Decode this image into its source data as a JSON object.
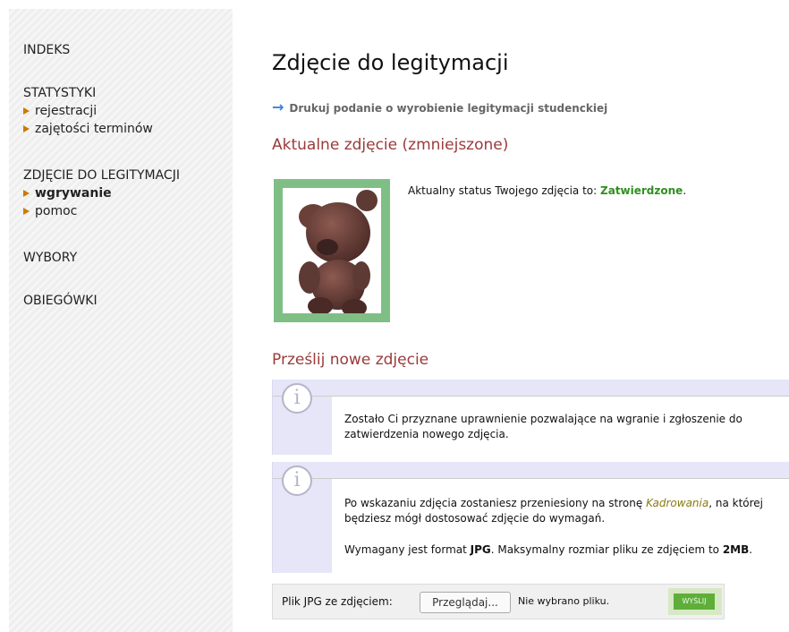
{
  "sidebar": {
    "indeks": "INDEKS",
    "statystyki": "STATYSTYKI",
    "statystyki_items": [
      "rejestracji",
      "zajętości terminów"
    ],
    "zdjecie": "ZDJĘCIE DO LEGITYMACJI",
    "zdjecie_items": [
      "wgrywanie",
      "pomoc"
    ],
    "wybory": "WYBORY",
    "obiegowki": "OBIEGÓWKI"
  },
  "main": {
    "title": "Zdjęcie do legitymacji",
    "print_link": "Drukuj podanie o wyrobienie legitymacji studenckiej",
    "current_heading": "Aktualne zdjęcie (zmniejszone)",
    "status_prefix": "Aktualny status Twojego zdjęcia to:",
    "status_value": "Zatwierdzone",
    "status_suffix": ".",
    "upload_heading": "Prześlij nowe zdjęcie",
    "info1": "Zostało Ci przyznane uprawnienie pozwalające na wgranie i zgłoszenie do zatwierdzenia nowego zdjęcia.",
    "info2_a": "Po wskazaniu zdjęcia zostaniesz przeniesiony na stronę ",
    "info2_link": "Kadrowania",
    "info2_b": ", na której będziesz mógł dostosować zdjęcie do wymagań.",
    "info3_a": "Wymagany jest format ",
    "info3_fmt": "JPG",
    "info3_b": ". Maksymalny rozmiar pliku ze zdjęciem to ",
    "info3_size": "2MB",
    "info3_c": "."
  },
  "upload": {
    "label": "Plik JPG ze zdjęciem:",
    "browse": "Przeglądaj...",
    "filename": "Nie wybrano pliku.",
    "send": "WYŚLIJ"
  },
  "colors": {
    "heading": "#9b3a3a",
    "approved": "#2f8f1f",
    "accent_link": "#3f7fd6"
  }
}
